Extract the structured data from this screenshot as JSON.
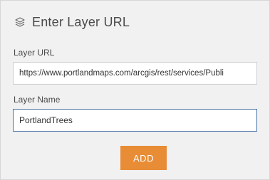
{
  "header": {
    "icon": "layers-icon",
    "title": "Enter Layer URL"
  },
  "form": {
    "url_label": "Layer URL",
    "url_value": "https://www.portlandmaps.com/arcgis/rest/services/Publi",
    "name_label": "Layer Name",
    "name_value": "PortlandTrees",
    "add_label": "ADD"
  },
  "colors": {
    "panel_bg": "#f1f1f1",
    "accent": "#e88c36",
    "focus_border": "#4b74a8"
  }
}
